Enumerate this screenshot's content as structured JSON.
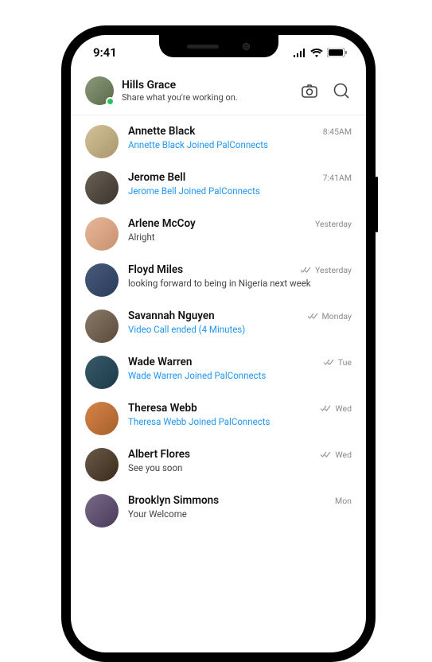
{
  "status_bar": {
    "time": "9:41"
  },
  "header": {
    "name": "Hills Grace",
    "subtitle": "Share what you're working on."
  },
  "chats": [
    {
      "name": "Annette Black",
      "preview": "Annette Black Joined PalConnects",
      "time": "8:45AM",
      "link": true,
      "read": false
    },
    {
      "name": "Jerome Bell",
      "preview": "Jerome Bell Joined PalConnects",
      "time": "7:41AM",
      "link": true,
      "read": false
    },
    {
      "name": "Arlene McCoy",
      "preview": "Alright",
      "time": "Yesterday",
      "link": false,
      "read": false
    },
    {
      "name": "Floyd Miles",
      "preview": "looking forward to being in Nigeria next week",
      "time": "Yesterday",
      "link": false,
      "read": true
    },
    {
      "name": "Savannah Nguyen",
      "preview": "Video Call ended (4 Minutes)",
      "time": "Monday",
      "link": true,
      "read": true
    },
    {
      "name": "Wade Warren",
      "preview": "Wade Warren Joined PalConnects",
      "time": "Tue",
      "link": true,
      "read": true
    },
    {
      "name": "Theresa Webb",
      "preview": "Theresa Webb Joined PalConnects",
      "time": "Wed",
      "link": true,
      "read": true
    },
    {
      "name": "Albert Flores",
      "preview": "See you soon",
      "time": "Wed",
      "link": false,
      "read": true
    },
    {
      "name": "Brooklyn Simmons",
      "preview": "Your Welcome",
      "time": "Mon",
      "link": false,
      "read": false
    }
  ]
}
